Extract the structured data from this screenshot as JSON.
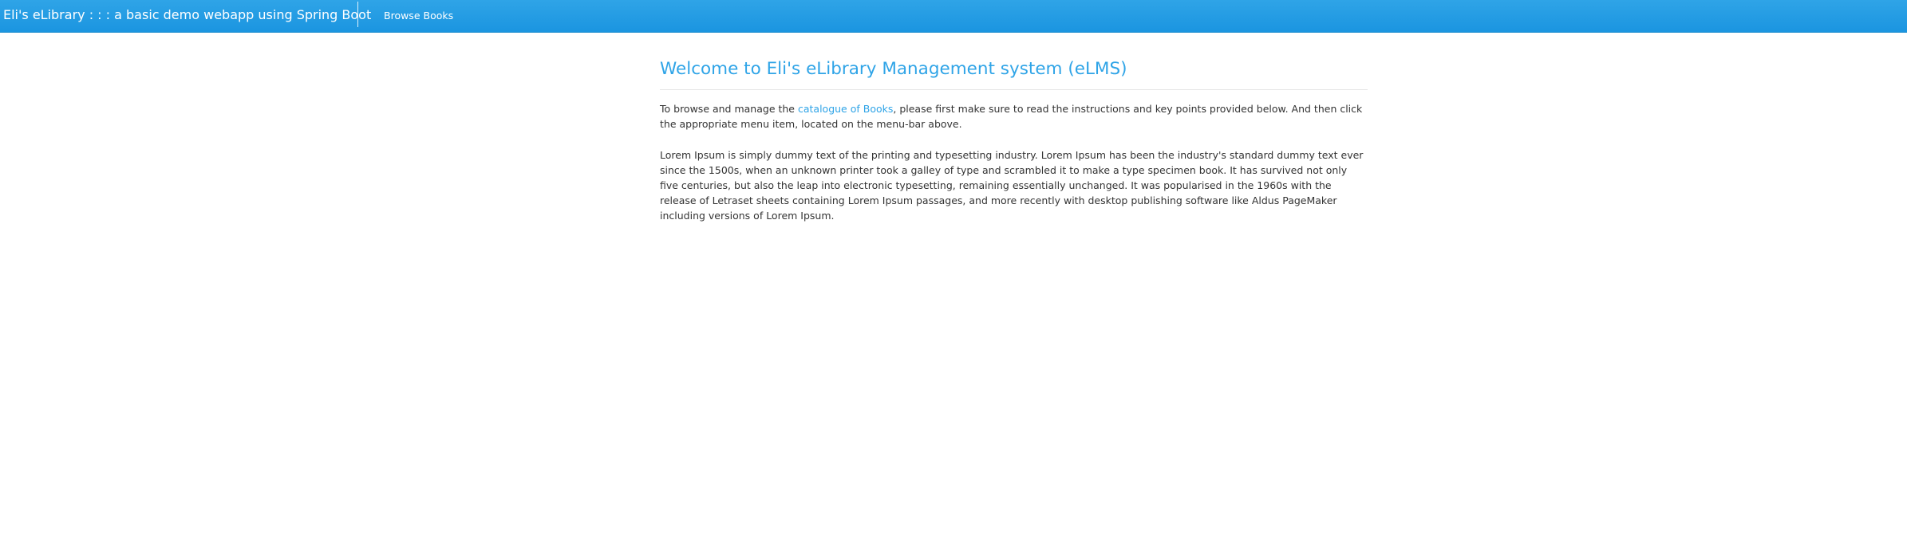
{
  "navbar": {
    "brand": "Eli's eLibrary : : : a basic demo webapp using Spring Boot",
    "links": [
      {
        "label": "Browse Books"
      }
    ]
  },
  "main": {
    "title": "Welcome to Eli's eLibrary Management system (eLMS)",
    "intro": {
      "before": "To browse and manage the ",
      "link": "catalogue of Books",
      "after": ", please first make sure to read the instructions and key points provided below. And then click the appropriate menu item, located on the menu-bar above."
    },
    "lorem": "Lorem Ipsum is simply dummy text of the printing and typesetting industry. Lorem Ipsum has been the industry's standard dummy text ever since the 1500s, when an unknown printer took a galley of type and scrambled it to make a type specimen book. It has survived not only five centuries, but also the leap into electronic typesetting, remaining essentially unchanged. It was popularised in the 1960s with the release of Letraset sheets containing Lorem Ipsum passages, and more recently with desktop publishing software like Aldus PageMaker including versions of Lorem Ipsum."
  },
  "colors": {
    "navbar": "#2fa4e7",
    "accent": "#2fa4e7",
    "text": "#333333"
  }
}
